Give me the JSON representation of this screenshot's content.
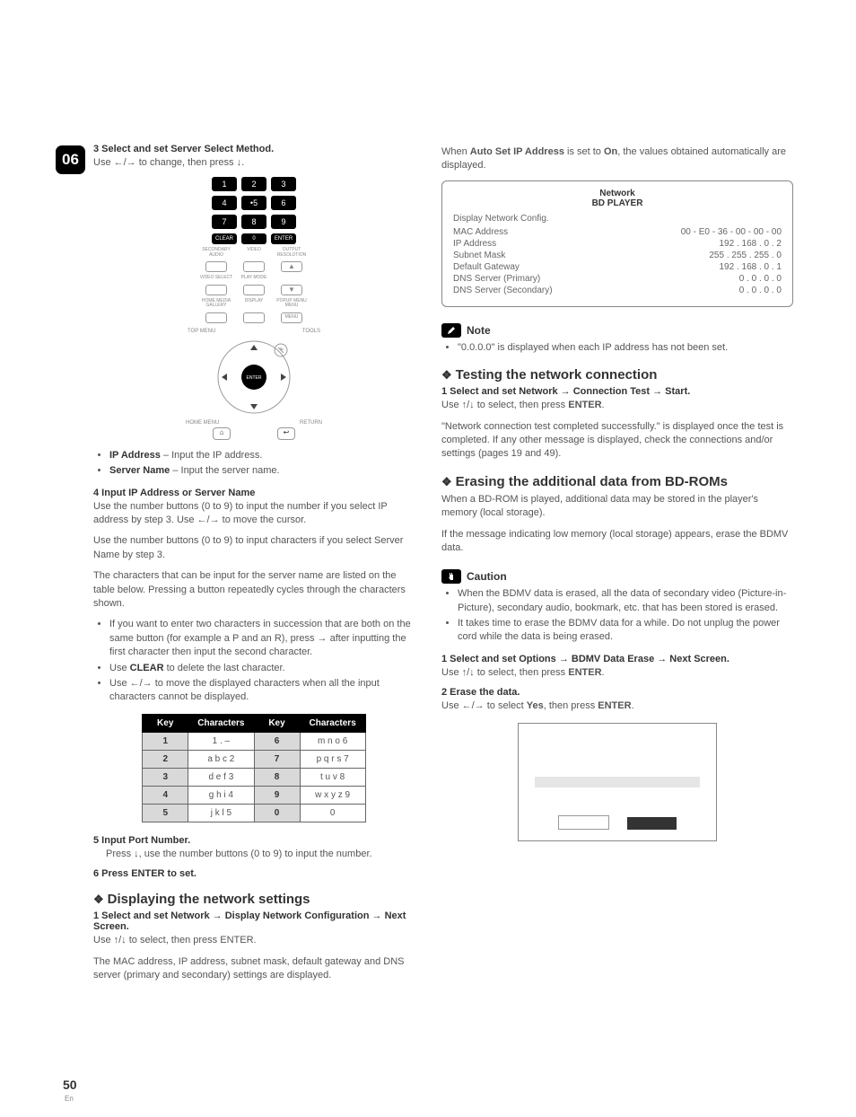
{
  "chapter": "06",
  "left": {
    "step3_title": "3   Select and set Server Select Method.",
    "step3_body": "Use ←/→ to change, then press ↓.",
    "remote_num": [
      "1",
      "2",
      "3",
      "4",
      "•5",
      "6",
      "7",
      "8",
      "9"
    ],
    "remote_row2": [
      "CLEAR",
      "0",
      "ENTER"
    ],
    "remote_labels1": [
      "SECONDARY AUDIO",
      "VIDEO",
      "OUTPUT RESOLUTION"
    ],
    "remote_labels2": [
      "VIDEO SELECT",
      "PLAY MODE",
      ""
    ],
    "remote_labels3": [
      "HOME MEDIA GALLERY",
      "DISPLAY",
      "POPUP MENU MENU"
    ],
    "remote_top": "TOP MENU",
    "remote_tools": "TOOLS",
    "remote_enter": "ENTER",
    "remote_home": "HOME MENU",
    "remote_return": "RETURN",
    "bullet_ip_b": "IP Address",
    "bullet_ip_t": " – Input the IP address.",
    "bullet_sn_b": "Server Name",
    "bullet_sn_t": " – Input the server name.",
    "step4_title": "4   Input IP Address or Server Name",
    "step4_body1": "Use the number buttons (0 to 9) to input the number if you select IP address by step 3. Use ←/→ to move the cursor.",
    "step4_body2": "Use the number buttons (0 to 9) to input characters if you select Server Name by step 3.",
    "step4_body3": "The characters that can be input for the server name are listed on the table below. Pressing a button repeatedly cycles through the characters shown.",
    "step4_li1": "If you want to enter two characters in succession that are both on the same button (for example a P and an R), press → after inputting the first character then input the second character.",
    "step4_li2_a": "Use ",
    "step4_li2_b": "CLEAR",
    "step4_li2_c": " to delete the last character.",
    "step4_li3": "Use ←/→ to move the displayed characters when all the input characters cannot be displayed.",
    "th_key": "Key",
    "th_chars": "Characters",
    "chartable": [
      {
        "k": "1",
        "c": "1 . –",
        "k2": "6",
        "c2": "m n o 6"
      },
      {
        "k": "2",
        "c": "a b c 2",
        "k2": "7",
        "c2": "p q r s 7"
      },
      {
        "k": "3",
        "c": "d e f 3",
        "k2": "8",
        "c2": "t u v 8"
      },
      {
        "k": "4",
        "c": "g h i 4",
        "k2": "9",
        "c2": "w x y z 9"
      },
      {
        "k": "5",
        "c": "j k l 5",
        "k2": "0",
        "c2": "0"
      }
    ],
    "step5_title": "5   Input Port Number.",
    "step5_body": "Press ↓, use the number buttons (0 to 9) to input the number.",
    "step6_title": "6   Press ENTER to set.",
    "sec_display": "Displaying the network settings",
    "disp_step1": "1   Select and set Network → Display Network Configuration → Next Screen.",
    "disp_body1": "Use ↑/↓ to select, then press ENTER.",
    "disp_body2": "The MAC address, IP address, subnet mask, default gateway and DNS server (primary and secondary) settings are displayed."
  },
  "right": {
    "intro": "When Auto Set IP Address is set to On, the values obtained automatically are displayed.",
    "net_title": "Network",
    "net_sub": "BD PLAYER",
    "net_head": "Display Network Config.",
    "rows": [
      {
        "l": "MAC Address",
        "v": "00 - E0 - 36 - 00 - 00 - 00"
      },
      {
        "l": "IP Address",
        "v": "192 . 168 .    0 .    2"
      },
      {
        "l": "Subnet Mask",
        "v": "255 . 255 . 255 .    0"
      },
      {
        "l": "Default Gateway",
        "v": "192 . 168 .    0 .    1"
      },
      {
        "l": "DNS Server (Primary)",
        "v": "0 .    0 .    0 .    0"
      },
      {
        "l": "DNS Server (Secondary)",
        "v": "0 .    0 .    0 .    0"
      }
    ],
    "note_label": "Note",
    "note_li": "\"0.0.0.0\" is displayed when each IP address has not been set.",
    "sec_test": "Testing the network connection",
    "test_step1": "1   Select and set Network → Connection Test → Start.",
    "test_body1": "Use ↑/↓ to select, then press ENTER.",
    "test_body2": "\"Network connection test completed successfully.\" is displayed once the test is completed. If any other message is displayed, check the connections and/or settings (pages 19 and 49).",
    "sec_erase": "Erasing the additional data from BD-ROMs",
    "erase_body1": "When a BD-ROM is played, additional data may be stored in the player's memory (local storage).",
    "erase_body2": "If the message indicating low memory (local storage) appears, erase the BDMV data.",
    "caution_label": "Caution",
    "caution_li1": "When the BDMV data is erased, all the data of secondary video (Picture-in-Picture), secondary audio, bookmark, etc. that has been stored is erased.",
    "caution_li2": "It takes time to erase the BDMV data for a while. Do not unplug the power cord while the data is being erased.",
    "erase_step1": "1   Select and set Options → BDMV Data Erase → Next Screen.",
    "erase_step1b": "Use ↑/↓ to select, then press ENTER.",
    "erase_step2": "2   Erase the data.",
    "erase_step2b": "Use ←/→ to select Yes, then press ENTER."
  },
  "page_num": "50",
  "page_lang": "En"
}
